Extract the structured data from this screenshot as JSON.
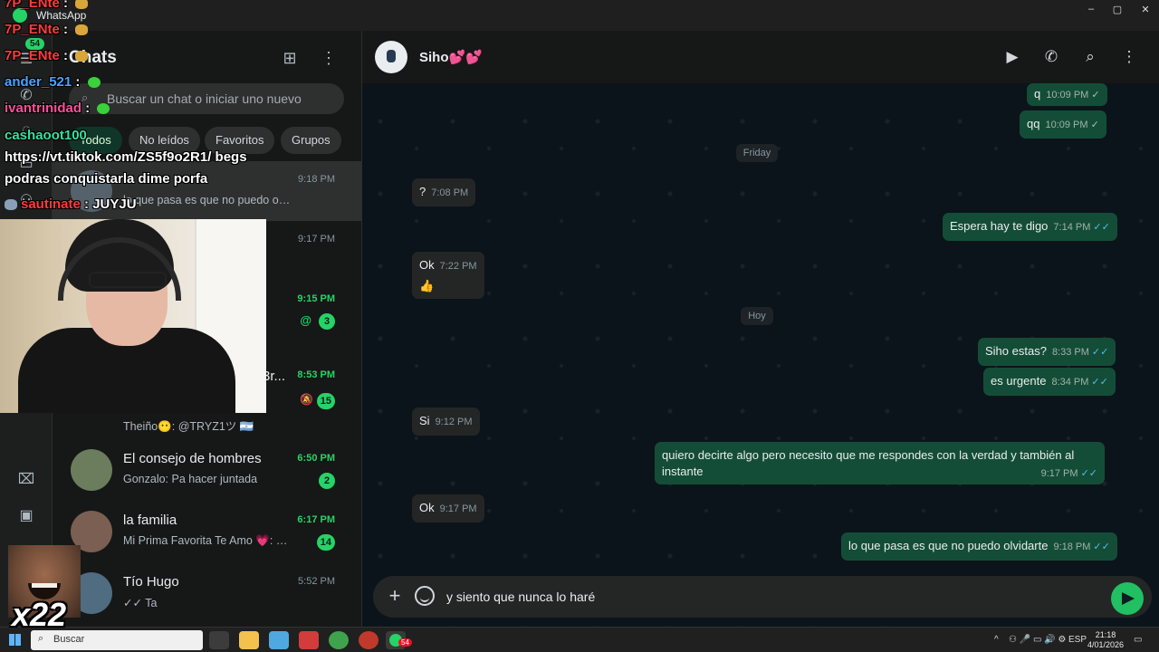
{
  "window": {
    "title": "WhatsApp",
    "controls": [
      "–",
      "▢",
      "✕"
    ]
  },
  "rail": {
    "chats_badge": "54"
  },
  "chat_list": {
    "title": "Chats",
    "search_placeholder": "Buscar un chat o iniciar uno nuevo",
    "filters": [
      "Todos",
      "No leídos",
      "Favoritos",
      "Grupos"
    ],
    "chats": [
      {
        "name": "",
        "preview": "lo que pasa es que no puedo olvidar...",
        "time": "9:18 PM",
        "badge": "",
        "unread": false,
        "selected": true
      },
      {
        "name": "",
        "preview": "",
        "time": "9:17 PM",
        "badge": "",
        "unread": false
      },
      {
        "name": "",
        "preview": "",
        "time": "9:15 PM",
        "badge": "3",
        "unread": true,
        "mention": "@"
      },
      {
        "name": "3r...",
        "preview": "Theiño😶: @TRYZ1ツ 🇦🇷",
        "time": "8:53 PM",
        "badge": "15",
        "unread": true,
        "muted": true
      },
      {
        "name": "El consejo de hombres",
        "preview": "Gonzalo: Pa hacer juntada",
        "time": "6:50 PM",
        "badge": "2",
        "unread": true
      },
      {
        "name": "la familia",
        "preview": "Mi Prima Favorita Te Amo 💗: 🎤 0...",
        "time": "6:17 PM",
        "badge": "14",
        "unread": true
      },
      {
        "name": "Tío Hugo",
        "preview": "✓✓ Ta",
        "time": "5:52 PM",
        "badge": "",
        "unread": false
      }
    ]
  },
  "conversation": {
    "contact_name": "Siho💕💕",
    "messages": [
      {
        "dir": "out",
        "text": "q",
        "time": "10:09 PM",
        "read": false
      },
      {
        "dir": "out",
        "text": "qq",
        "time": "10:09 PM",
        "read": false
      },
      {
        "dir": "sep",
        "text": "Friday"
      },
      {
        "dir": "in",
        "text": "?",
        "time": "7:08 PM"
      },
      {
        "dir": "out",
        "text": "Espera hay te digo",
        "time": "7:14 PM",
        "read": true
      },
      {
        "dir": "in",
        "text": "Ok",
        "extra": "👍",
        "time": "7:22 PM"
      },
      {
        "dir": "sep",
        "text": "Hoy"
      },
      {
        "dir": "out",
        "text": "Siho estas?",
        "time": "8:33 PM",
        "read": true
      },
      {
        "dir": "out",
        "text": "es urgente",
        "time": "8:34 PM",
        "read": true
      },
      {
        "dir": "in",
        "text": "Si",
        "time": "9:12 PM"
      },
      {
        "dir": "out",
        "text": "quiero decirte algo pero necesito que me respondes con la verdad y también al instante",
        "time": "9:17 PM",
        "read": true
      },
      {
        "dir": "in",
        "text": "Ok",
        "time": "9:17 PM"
      },
      {
        "dir": "out",
        "text": "lo que pasa es que no puedo olvidarte",
        "time": "9:18 PM",
        "read": true
      }
    ],
    "composer_text": "y siento que nunca lo haré"
  },
  "taskbar": {
    "search_label": "Buscar",
    "app_badge": "54",
    "lang": "ESP",
    "time": "21:18",
    "date": "4/01/2026"
  },
  "stream_chat": [
    {
      "user": "7P_ENte",
      "msg": ""
    },
    {
      "user": "7P_ENte",
      "msg": ""
    },
    {
      "user": "7P_ENte",
      "msg": ""
    },
    {
      "user": "ander_521",
      "msg": "",
      "color": "#4aa3ff"
    },
    {
      "user": "ivantrinidad",
      "msg": "",
      "color": "#ff4f9a"
    },
    {
      "user": "cashaoot100",
      "msg": "",
      "color": "#35e0a0"
    },
    {
      "user": "",
      "msg": "https://vt.tiktok.com/ZS5f9o2R1/ begs"
    },
    {
      "user": "",
      "msg": "podras conquistarla dime porfa"
    },
    {
      "user": "sautinate",
      "msg": "JUYJU"
    }
  ],
  "overlay": {
    "multiplier": "x22"
  },
  "colors": {
    "accent": "#25d366",
    "outgoing_bubble": "#144d37",
    "incoming_bubble": "#242626",
    "read_tick": "#53bdeb"
  }
}
